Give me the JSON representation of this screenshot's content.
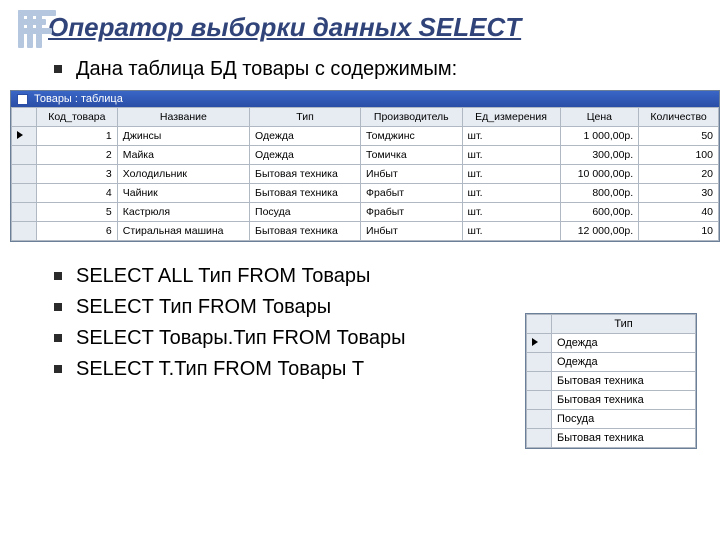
{
  "title": "Оператор выборки данных SELECT",
  "intro": "Дана таблица БД товары с содержимым:",
  "window_title": "Товары : таблица",
  "columns": [
    "Код_товара",
    "Название",
    "Тип",
    "Производитель",
    "Ед_измерения",
    "Цена",
    "Количество"
  ],
  "rows": [
    {
      "id": "1",
      "name": "Джинсы",
      "type": "Одежда",
      "maker": "Томджинс",
      "unit": "шт.",
      "price": "1 000,00р.",
      "qty": "50"
    },
    {
      "id": "2",
      "name": "Майка",
      "type": "Одежда",
      "maker": "Томичка",
      "unit": "шт.",
      "price": "300,00р.",
      "qty": "100"
    },
    {
      "id": "3",
      "name": "Холодильник",
      "type": "Бытовая техника",
      "maker": "Инбыт",
      "unit": "шт.",
      "price": "10 000,00р.",
      "qty": "20"
    },
    {
      "id": "4",
      "name": "Чайник",
      "type": "Бытовая техника",
      "maker": "Фрабыт",
      "unit": "шт.",
      "price": "800,00р.",
      "qty": "30"
    },
    {
      "id": "5",
      "name": "Кастрюля",
      "type": "Посуда",
      "maker": "Фрабыт",
      "unit": "шт.",
      "price": "600,00р.",
      "qty": "40"
    },
    {
      "id": "6",
      "name": "Стиральная машина",
      "type": "Бытовая техника",
      "maker": "Инбыт",
      "unit": "шт.",
      "price": "12 000,00р.",
      "qty": "10"
    }
  ],
  "queries": [
    "SELECT ALL Тип FROM Товары",
    "SELECT Тип FROM Товары",
    "SELECT Товары.Тип FROM Товары",
    "SELECT T.Тип FROM Товары T"
  ],
  "result_header": "Тип",
  "result_rows": [
    "Одежда",
    "Одежда",
    "Бытовая техника",
    "Бытовая техника",
    "Посуда",
    "Бытовая техника"
  ]
}
